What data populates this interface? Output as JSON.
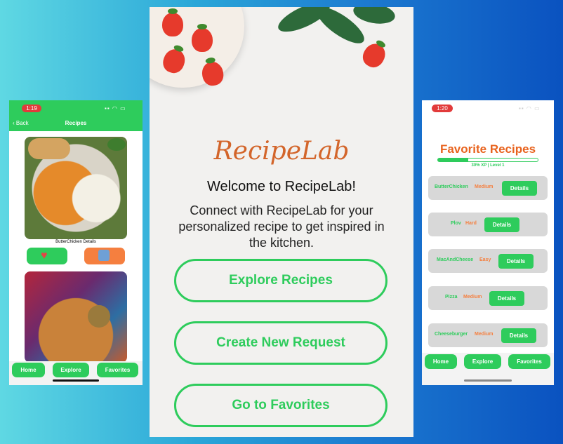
{
  "left_phone": {
    "status_time": "1:19",
    "back_label": "Back",
    "title": "Recipes",
    "caption": "ButterChicken Details",
    "tabs": [
      "Home",
      "Explore",
      "Favorites"
    ]
  },
  "center": {
    "brand": "RecipeLab",
    "welcome": "Welcome to RecipeLab!",
    "subtitle": "Connect with RecipeLab for your personalized recipe to get inspired in the kitchen.",
    "buttons": [
      "Explore Recipes",
      "Create New Request",
      "Go to Favorites"
    ]
  },
  "right_phone": {
    "status_time": "1:20",
    "title": "Favorite Recipes",
    "xp_text": "30% XP | Level 1",
    "xp_percent": 30,
    "details_label": "Details",
    "favorites": [
      {
        "name": "ButterChicken",
        "difficulty": "Medium"
      },
      {
        "name": "Plov",
        "difficulty": "Hard"
      },
      {
        "name": "MacAndCheese",
        "difficulty": "Easy"
      },
      {
        "name": "Pizza",
        "difficulty": "Medium"
      },
      {
        "name": "Cheeseburger",
        "difficulty": "Medium"
      }
    ],
    "tabs": [
      "Home",
      "Explore",
      "Favorites"
    ]
  },
  "colors": {
    "accent_green": "#2ecc5c",
    "accent_orange": "#f57f3f",
    "brand_orange": "#d3652a"
  }
}
